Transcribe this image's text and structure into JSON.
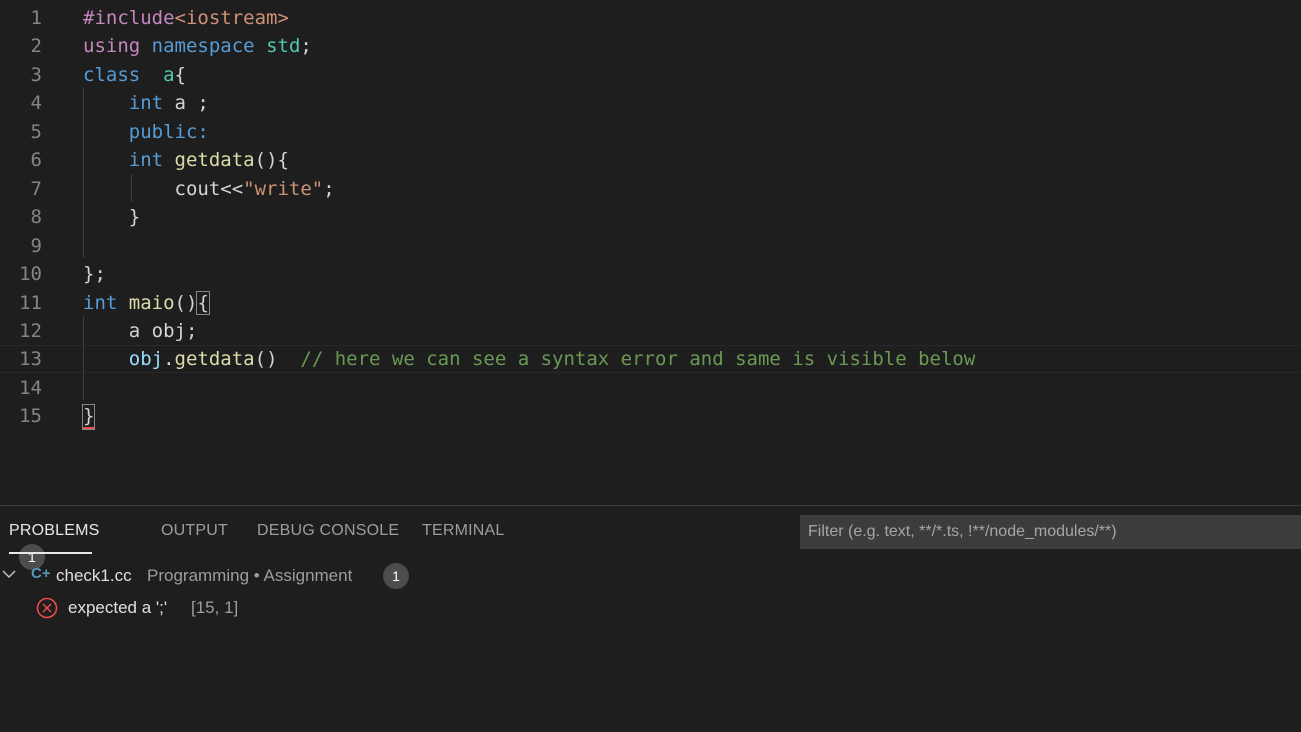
{
  "editor": {
    "lines": [
      {
        "num": "1",
        "tokens": [
          [
            "pp",
            "#include"
          ],
          [
            "str",
            "<iostream>"
          ]
        ]
      },
      {
        "num": "2",
        "tokens": [
          [
            "ctl",
            "using"
          ],
          [
            "txt",
            " "
          ],
          [
            "kw",
            "namespace"
          ],
          [
            "txt",
            " "
          ],
          [
            "type",
            "std"
          ],
          [
            "txt",
            ";"
          ]
        ]
      },
      {
        "num": "3",
        "tokens": [
          [
            "kw",
            "class"
          ],
          [
            "txt",
            "  "
          ],
          [
            "type",
            "a"
          ],
          [
            "txt",
            "{"
          ]
        ]
      },
      {
        "num": "4",
        "tokens": [
          [
            "txt",
            "    "
          ],
          [
            "kw",
            "int"
          ],
          [
            "txt",
            " a ;"
          ]
        ]
      },
      {
        "num": "5",
        "tokens": [
          [
            "txt",
            "    "
          ],
          [
            "kw",
            "public:"
          ]
        ]
      },
      {
        "num": "6",
        "tokens": [
          [
            "txt",
            "    "
          ],
          [
            "kw",
            "int"
          ],
          [
            "txt",
            " "
          ],
          [
            "fn",
            "getdata"
          ],
          [
            "txt",
            "(){"
          ]
        ]
      },
      {
        "num": "7",
        "tokens": [
          [
            "txt",
            "        cout<<"
          ],
          [
            "str",
            "\"write\""
          ],
          [
            "txt",
            ";"
          ]
        ]
      },
      {
        "num": "8",
        "tokens": [
          [
            "txt",
            "    }"
          ]
        ]
      },
      {
        "num": "9",
        "tokens": []
      },
      {
        "num": "10",
        "tokens": [
          [
            "txt",
            "};"
          ]
        ]
      },
      {
        "num": "11",
        "tokens": [
          [
            "kw",
            "int"
          ],
          [
            "txt",
            " "
          ],
          [
            "fn",
            "maio"
          ],
          [
            "txt",
            "()"
          ],
          [
            "box",
            "{"
          ]
        ]
      },
      {
        "num": "12",
        "tokens": [
          [
            "txt",
            "    a obj;"
          ]
        ]
      },
      {
        "num": "13",
        "tokens": [
          [
            "txt",
            "    "
          ],
          [
            "var",
            "obj"
          ],
          [
            "txt",
            "."
          ],
          [
            "fn",
            "getdata"
          ],
          [
            "txt",
            "()  "
          ],
          [
            "cm",
            "// here we can see a syntax error and same is visible below"
          ]
        ]
      },
      {
        "num": "14",
        "tokens": []
      },
      {
        "num": "15",
        "tokens": [
          [
            "boxsq",
            "}"
          ]
        ]
      }
    ]
  },
  "panel": {
    "tabs": {
      "problems": "PROBLEMS",
      "problems_count": "1",
      "output": "OUTPUT",
      "debug_console": "DEBUG CONSOLE",
      "terminal": "TERMINAL"
    },
    "filter_placeholder": "Filter (e.g. text, **/*.ts, !**/node_modules/**)",
    "file": {
      "icon_glyph": "C+",
      "name": "check1.cc",
      "path": "Programming • Assignment",
      "count": "1"
    },
    "error": {
      "message": "expected a ';'",
      "location": "[15, 1]"
    }
  }
}
